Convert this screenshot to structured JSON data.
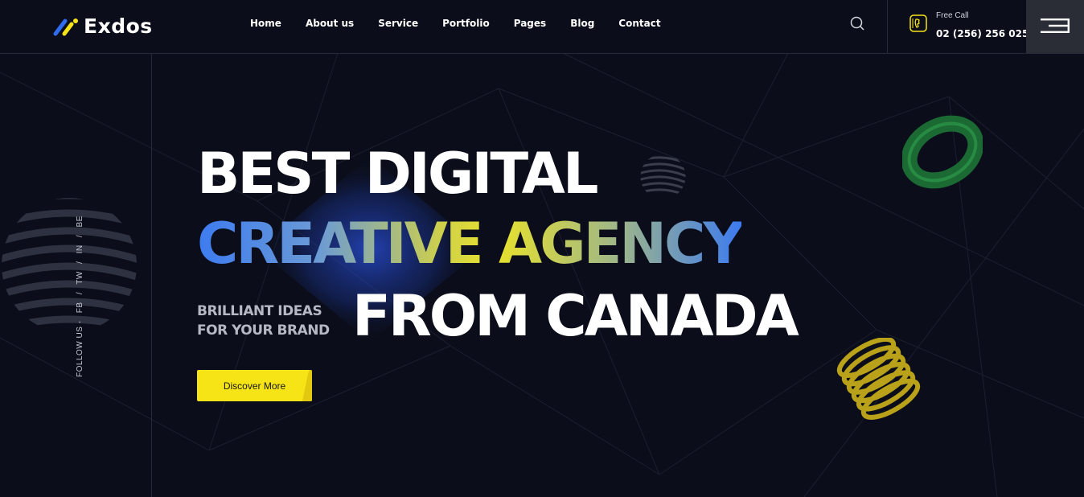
{
  "header": {
    "logo_text": "Exdos",
    "nav": [
      "Home",
      "About us",
      "Service",
      "Portfolio",
      "Pages",
      "Blog",
      "Contact"
    ],
    "call": {
      "label": "Free Call",
      "number": "02 (256) 256 025"
    }
  },
  "social": {
    "follow_label": "FOLLOW US -",
    "links": [
      "FB",
      "/",
      "TW",
      "/",
      "IN",
      "/",
      "BE"
    ]
  },
  "hero": {
    "line1": "BEST DIGITAL",
    "line2": "CREATIVE AGENCY",
    "tagline_1": "BRILLIANT IDEAS",
    "tagline_2": "FOR YOUR BRAND",
    "line3": "FROM CANADA",
    "cta": "Discover More"
  },
  "colors": {
    "background": "#0b0e1a",
    "accent_yellow": "#f7e417",
    "accent_blue": "#3d7bf0",
    "accent_green": "#1f7a3a"
  },
  "icons": [
    "search-icon",
    "phone-icon",
    "hamburger-menu-icon",
    "logo-mark-icon"
  ]
}
